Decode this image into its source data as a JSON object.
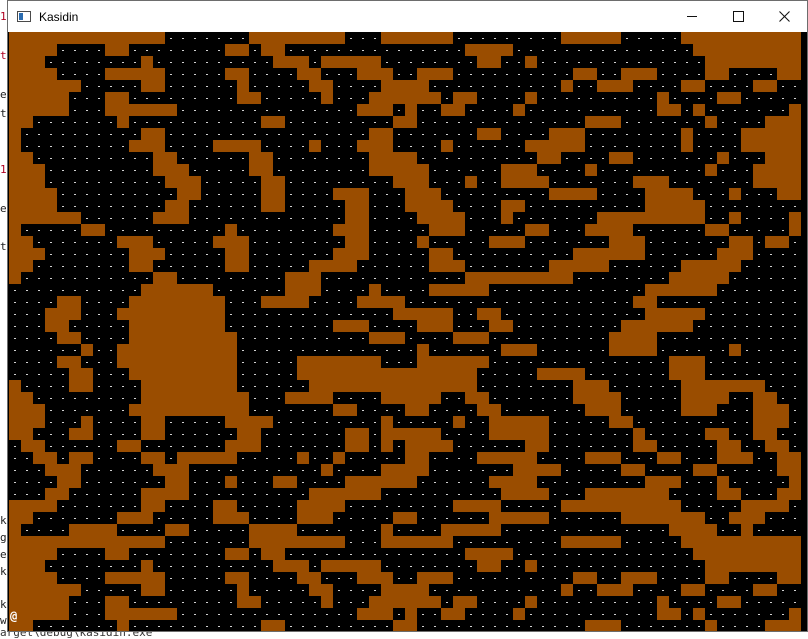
{
  "window": {
    "title": "Kasidin",
    "controls": {
      "minimize_icon": "minimize-icon",
      "maximize_icon": "maximize-icon",
      "close_icon": "close-icon"
    }
  },
  "background_editor": {
    "fragments": [
      "1",
      "t",
      "e",
      "t",
      "1",
      "e",
      "t",
      "ke",
      "g",
      "ev",
      "ka",
      "ke",
      "w"
    ],
    "status_line": "arget\\debug\\kasidin.exe`"
  },
  "game": {
    "player_glyph": "@",
    "colors": {
      "cave_floor": "#000000",
      "rock": "#9a4d00",
      "floor_dot": "#d0d0d0"
    },
    "tile_grid": {
      "cols": 66,
      "rows": 50,
      "rock_legend": "#",
      "floor_legend": ".",
      "map": [
        "#############.......########...######.........#####.....######",
        "####....##........##.##...............####...............######",
        "###........#..........###.#####........##..#..............##########",
        "####....#####.....##....##...###..###..........##..###....##....####",
        "######.....##......#.....##....####...........#..###....##....##....",
        "#####...##.........##.....#...######.##....#..........#....##.......",
        "#####...######...............###.#..##....#...........##.#.......##",
        "##.......#...........##.........##..............###.......#....#####",
        "#..........##.................##.......##....###........#....#######",
        "#.........###....####....#...###....#......#####........#....#######",
        "##..........##......##........####..........##....##.......#...######",
        "###.........###.....##........#####......###....#.........#...#######",
        "###..........###.....##.........###...#..####.......###.......######",
        "####..........##.....##....###...###.........####....####...#...#####",
        "####.........##......##.....##...####....##..........#####........##",
        "######......###.............##....####...#.......#########..#....###",
        "#.....##..........#........###.....###.....##...####......##.....###",
        "##.......###.....###........##....#.....###.......###.......##.##..##",
        "###.......###.....##.......###.....##..........######......###....##",
        "##........##......##.....####......###.......#####......#####.....#",
        "#...........##.........###............#########........#####.......",
        "...........######......###....#....#####.............######........",
        "....##....########...####....####...................##...........",
        "...###...#########..............#####..##............#####......",
        "...##.....########.........###....###...##.........######.......",
        "....##....#########...........###....###..........####.........",
        "......#..##########...............#......###......####......#.",
        "....##...##########.....#######...######...............###....",
        ".....##...#########.....###############.....####.......###....",
        "#....##....########......##############........###......######",
        "##.........#########...####....#####..##.......####.....####..",
        "###.......##########.......##....##....##.......###.....###...",
        "###...#....##.....####.........#.....#..#####.....##..........",
        "##...##....##......##.......##.#####....#####.......#.....##..",
        ".##......##.......###.......##.#.####......##.......##.....##.",
        "..##.##....##.#####.....#..#.....##....#####....###...##...###",
        "...###......###...........#....####.......####.....##....##..",
        "....##.......##...#...##....######......####.........###...#.",
        "...##......####..........######..........####...#######....##",
        "####.......##....##.....####.........####.....##########.....",
        "##.......###.....###....###.....##......#####......#######..#",
        "#....####....##.....####.......#....#####..............####.."
      ]
    },
    "player_position": {
      "row": 49,
      "col": 0
    }
  }
}
